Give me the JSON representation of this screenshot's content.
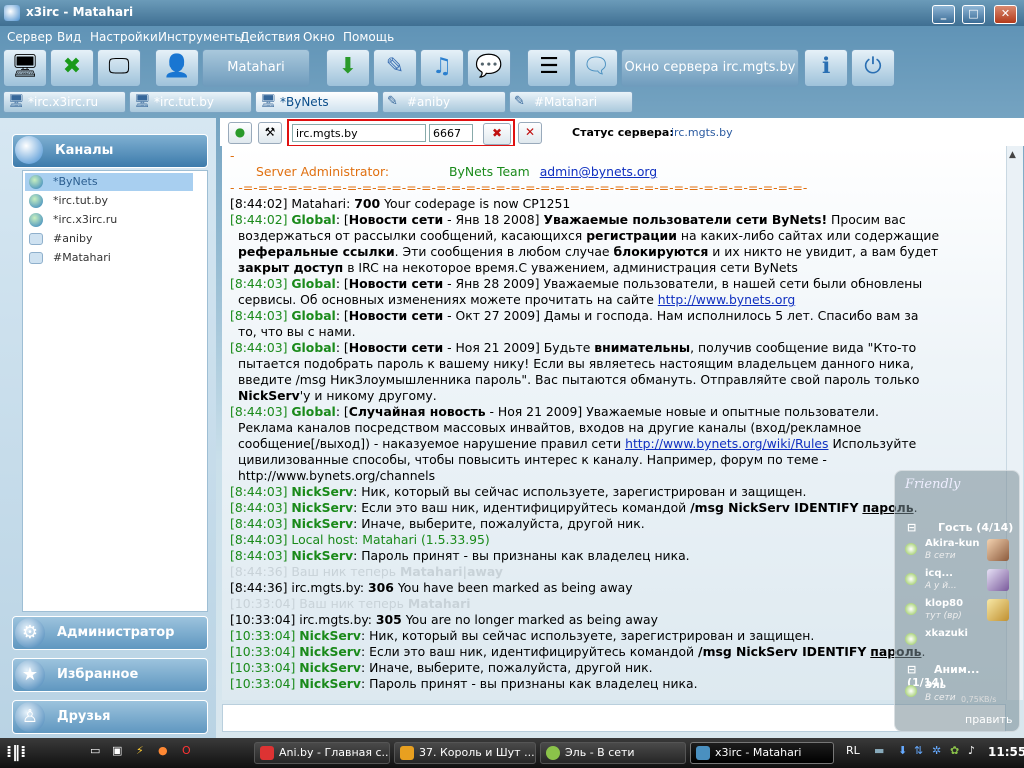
{
  "window": {
    "title": "x3irc - Matahari"
  },
  "menu": [
    "Сервер",
    "Вид",
    "Настройки",
    "Инструменты",
    "Действия",
    "Окно",
    "Помощь"
  ],
  "toolbar": {
    "nick_label": "Matahari",
    "server_window_label": "Окно сервера irc.mgts.by"
  },
  "tabs": [
    "*irc.x3irc.ru",
    "*irc.tut.by",
    "*ByNets",
    "#aniby",
    "#Matahari"
  ],
  "sidebar": {
    "header": "Каналы",
    "channels": [
      "*ByNets",
      "*irc.tut.by",
      "*irc.x3irc.ru",
      "#aniby",
      "#Matahari"
    ],
    "buttons": [
      "Администратор",
      "Избранное",
      "Друзья"
    ]
  },
  "server_bar": {
    "host": "irc.mgts.by",
    "port": "6667",
    "status_label": "Статус сервера:",
    "status_value": "irc.mgts.by"
  },
  "chat": {
    "l0": "-",
    "l1_role": "Server Administrator:",
    "l1_team": "ByNets Team",
    "l1_email": "admin@bynets.org",
    "l2": "- -=-=-=-=-=-=-=-=-=-=-=-=-=-=-=-=-=-=-=-=-=-=-=-=-=-=-=-=-=-=-=-=-=-=-=-=-=-=-",
    "l3_ts": "[8:44:02]",
    "l3_src": "Matahari:",
    "l3_code": "700",
    "l3_text": "Your codepage is now CP1251",
    "g1_ts": "[8:44:02]",
    "g1_src": "Global",
    "g1_a": ": [",
    "g1_b": "Новости сети",
    "g1_c": " - Янв 18 2008]",
    "g1_d": "Уважаемые пользователи сети ByNets!",
    "g1_e": "Просим вас",
    "g1_l2": "воздержаться от рассылки сообщений, касающихся",
    "g1_l2b": "регистрации",
    "g1_l2c": "на каких-либо сайтах или содержащие",
    "g1_l3a": "реферальные ссылки",
    "g1_l3b": ". Эти сообщения в любом случае",
    "g1_l3c": "блокируются",
    "g1_l3d": "и их никто не увидит, а вам будет",
    "g1_l4a": "закрыт доступ",
    "g1_l4b": "в IRC на некоторое время.С уважением, администрация сети ByNets",
    "g2_ts": "[8:44:03]",
    "g2_src": "Global",
    "g2_a": ": [",
    "g2_b": "Новости сети",
    "g2_c": " - Янв 28 2009] Уважаемые пользователи, в нашей сети были обновлены",
    "g2_l2": "сервисы. Об основных изменениях можете прочитать на сайте",
    "g2_link": "http://www.bynets.org",
    "g3_ts": "[8:44:03]",
    "g3_src": "Global",
    "g3_a": ": [",
    "g3_b": "Новости сети",
    "g3_c": " - Окт 27 2009] Дамы и господа. Нам исполнилось 5 лет. Спасибо вам за",
    "g3_l2": "то, что вы с нами.",
    "g4_ts": "[8:44:03]",
    "g4_src": "Global",
    "g4_a": ": [",
    "g4_b": "Новости сети",
    "g4_c": " - Ноя 21 2009] Будьте",
    "g4_d": "внимательны",
    "g4_e": ", получив сообщение вида \"Кто-то",
    "g4_l2": "пытается подобрать пароль к вашему нику! Если вы являетесь настоящим владельцем данного ника,",
    "g4_l3": "введите /msg НикЗлоумышленника пароль\". Вас пытаются обмануть. Отправляйте свой пароль только",
    "g4_l4a": "NickServ",
    "g4_l4b": "'у и никому другому.",
    "g5_ts": "[8:44:03]",
    "g5_src": "Global",
    "g5_a": ": [",
    "g5_b": "Случайная новость",
    "g5_c": " - Ноя 21 2009] Уважаемые новые и опытные пользователи.",
    "g5_l2": "Реклама каналов посредством массовых инвайтов, входов на другие каналы (вход/рекламное",
    "g5_l3": "сообщение[/выход]) - наказуемое нарушение правил сети",
    "g5_link": "http://www.bynets.org/wiki/Rules",
    "g5_l3b": "Используйте",
    "g5_l4": "цивилизованные способы, чтобы повысить интерес к каналу. Например, форум по теме -",
    "g5_l5": "http://www.bynets.org/channels",
    "n1_ts": "[8:44:03]",
    "n1_src": "NickServ",
    "n1_text": ": Ник, который вы сейчас используете, зарегистрирован и защищен.",
    "n2_ts": "[8:44:03]",
    "n2_src": "NickServ",
    "n2_a": ": Если это ваш ник, идентифицируйтесь командой",
    "n2_b": "/msg NickServ IDENTIFY",
    "n2_c": "пароль",
    "n3_ts": "[8:44:03]",
    "n3_src": "NickServ",
    "n3_text": ": Иначе, выберите, пожалуйста, другой ник.",
    "lh_ts": "[8:44:03]",
    "lh_text": "Local host: Matahari (1.5.33.95)",
    "n4_ts": "[8:44:03]",
    "n4_src": "NickServ",
    "n4_text": ": Пароль принят - вы признаны как владелец ника.",
    "f1_ts": "[8:44:36]",
    "f1_a": "Ваш ник теперь",
    "f1_b": "Matahari|away",
    "a1_ts": "[8:44:36]",
    "a1_src": "irc.mgts.by:",
    "a1_code": "306",
    "a1_text": "You have been marked as being away",
    "f2_ts": "[10:33:04]",
    "f2_a": "Ваш ник теперь",
    "f2_b": "Matahari",
    "a2_ts": "[10:33:04]",
    "a2_src": "irc.mgts.by:",
    "a2_code": "305",
    "a2_text": "You are no longer marked as being away",
    "m1_ts": "[10:33:04]",
    "m1_src": "NickServ",
    "m1_text": ": Ник, который вы сейчас используете, зарегистрирован и защищен.",
    "m2_ts": "[10:33:04]",
    "m2_src": "NickServ",
    "m2_a": ": Если это ваш ник, идентифицируйтесь командой",
    "m2_b": "/msg NickServ IDENTIFY",
    "m2_c": "пароль",
    "m3_ts": "[10:33:04]",
    "m3_src": "NickServ",
    "m3_text": ": Иначе, выберите, пожалуйста, другой ник.",
    "m4_ts": "[10:33:04]",
    "m4_src": "NickServ",
    "m4_text": ": Пароль принят - вы признаны как владелец ника."
  },
  "friendly": {
    "title": "Friendly",
    "group1": "Гость (4/14)",
    "users": [
      {
        "name": "Akira-kun",
        "status": "В сети"
      },
      {
        "name": "icq...",
        "status": "А у й..."
      },
      {
        "name": "klop80",
        "status": "тут (вр)"
      },
      {
        "name": "xkazuki",
        "status": ""
      }
    ],
    "group2": "Аним... (1/14)",
    "user5": {
      "name": "Эль",
      "status": "В сети"
    },
    "speed": "0,75KB/s",
    "send_label": "править"
  },
  "taskbar": {
    "tasks": [
      "Ani.by - Главная с...",
      "37. Король и Шут ...",
      "Эль - В сети",
      "x3irc - Matahari"
    ],
    "lang": "RL",
    "clock": "11:55"
  }
}
